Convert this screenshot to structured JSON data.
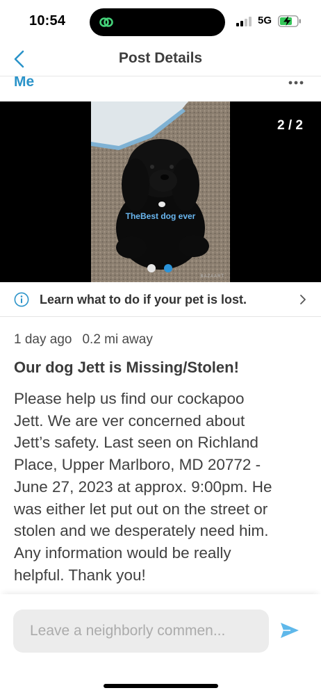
{
  "status_bar": {
    "time": "10:54",
    "network": "5G",
    "island_icon": "link-icon",
    "colors": {
      "island_icon": "#45d37a",
      "battery": "#34c759"
    }
  },
  "nav": {
    "title": "Post Details",
    "back_icon": "chevron-left-icon",
    "accent": "#2a93c9"
  },
  "author": {
    "name": "Me",
    "more_icon": "ellipsis-icon"
  },
  "carousel": {
    "counter": "2 / 2",
    "caption": "TheBest dog ever",
    "watermark": "BAZAART",
    "current_index": 2,
    "total": 2
  },
  "lost_banner": {
    "text": "Learn what to do if your pet is lost.",
    "icon": "info-icon"
  },
  "post": {
    "time_ago": "1 day ago",
    "distance": "0.2 mi away",
    "title": "Our dog Jett is Missing/Stolen!",
    "body_lines": [
      "Please help us find our cockapoo",
      "Jett.  We are ver concerned about",
      "Jett’s safety. Last seen on Richland",
      "Place, Upper Marlboro, MD 20772 -",
      "June 27, 2023 at approx. 9:00pm. He",
      "was either let put out on the street or",
      "stolen and we desperately need him.",
      "Any information would be really",
      "helpful. Thank you!"
    ]
  },
  "comment": {
    "placeholder": "Leave a neighborly commen...",
    "send_icon": "send-icon",
    "send_color": "#5fb8ea"
  }
}
